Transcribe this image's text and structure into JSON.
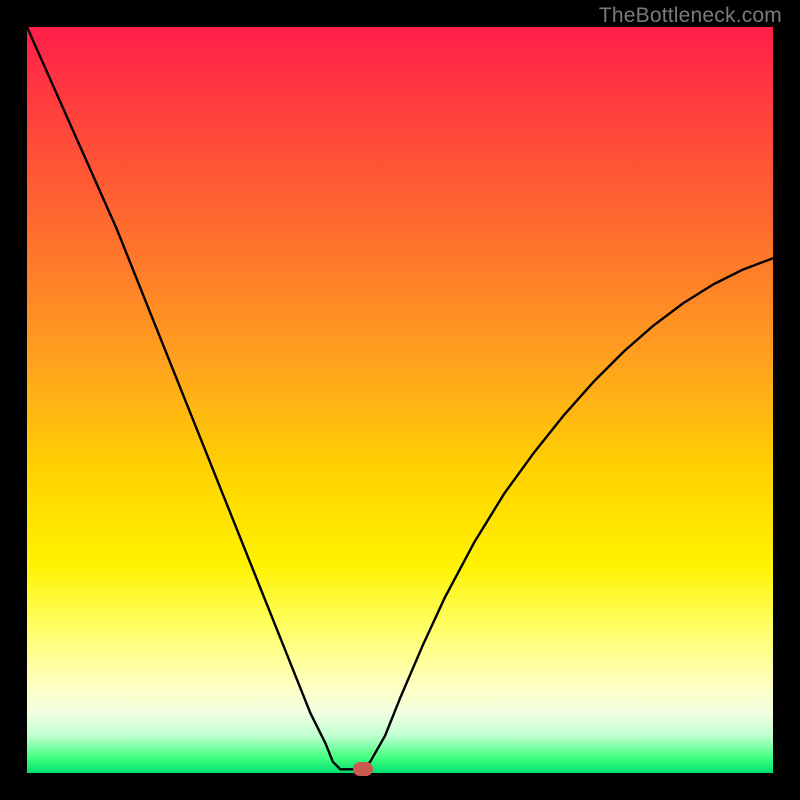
{
  "watermark": "TheBottleneck.com",
  "colors": {
    "marker": "#c85a50",
    "curve_stroke": "#000000"
  },
  "chart_data": {
    "type": "line",
    "title": "",
    "xlabel": "",
    "ylabel": "",
    "xlim": [
      0,
      100
    ],
    "ylim": [
      0,
      100
    ],
    "grid": false,
    "curve_points": [
      {
        "x": 0.0,
        "y": 100.0
      },
      {
        "x": 2.0,
        "y": 95.5
      },
      {
        "x": 4.0,
        "y": 91.0
      },
      {
        "x": 6.0,
        "y": 86.5
      },
      {
        "x": 8.0,
        "y": 82.0
      },
      {
        "x": 10.0,
        "y": 77.5
      },
      {
        "x": 12.0,
        "y": 73.0
      },
      {
        "x": 14.0,
        "y": 68.0
      },
      {
        "x": 16.0,
        "y": 63.0
      },
      {
        "x": 18.0,
        "y": 58.0
      },
      {
        "x": 20.0,
        "y": 53.0
      },
      {
        "x": 22.0,
        "y": 48.0
      },
      {
        "x": 24.0,
        "y": 43.0
      },
      {
        "x": 26.0,
        "y": 38.0
      },
      {
        "x": 28.0,
        "y": 33.0
      },
      {
        "x": 30.0,
        "y": 28.0
      },
      {
        "x": 32.0,
        "y": 23.0
      },
      {
        "x": 34.0,
        "y": 18.0
      },
      {
        "x": 36.0,
        "y": 13.0
      },
      {
        "x": 38.0,
        "y": 8.0
      },
      {
        "x": 40.0,
        "y": 4.0
      },
      {
        "x": 41.0,
        "y": 1.5
      },
      {
        "x": 42.0,
        "y": 0.5
      },
      {
        "x": 43.0,
        "y": 0.5
      },
      {
        "x": 44.0,
        "y": 0.5
      },
      {
        "x": 45.0,
        "y": 0.5
      },
      {
        "x": 46.0,
        "y": 1.5
      },
      {
        "x": 48.0,
        "y": 5.0
      },
      {
        "x": 50.0,
        "y": 10.0
      },
      {
        "x": 53.0,
        "y": 17.0
      },
      {
        "x": 56.0,
        "y": 23.5
      },
      {
        "x": 60.0,
        "y": 31.0
      },
      {
        "x": 64.0,
        "y": 37.5
      },
      {
        "x": 68.0,
        "y": 43.0
      },
      {
        "x": 72.0,
        "y": 48.0
      },
      {
        "x": 76.0,
        "y": 52.5
      },
      {
        "x": 80.0,
        "y": 56.5
      },
      {
        "x": 84.0,
        "y": 60.0
      },
      {
        "x": 88.0,
        "y": 63.0
      },
      {
        "x": 92.0,
        "y": 65.5
      },
      {
        "x": 96.0,
        "y": 67.5
      },
      {
        "x": 100.0,
        "y": 69.0
      }
    ],
    "marker": {
      "x": 45.0,
      "y": 0.5
    }
  }
}
